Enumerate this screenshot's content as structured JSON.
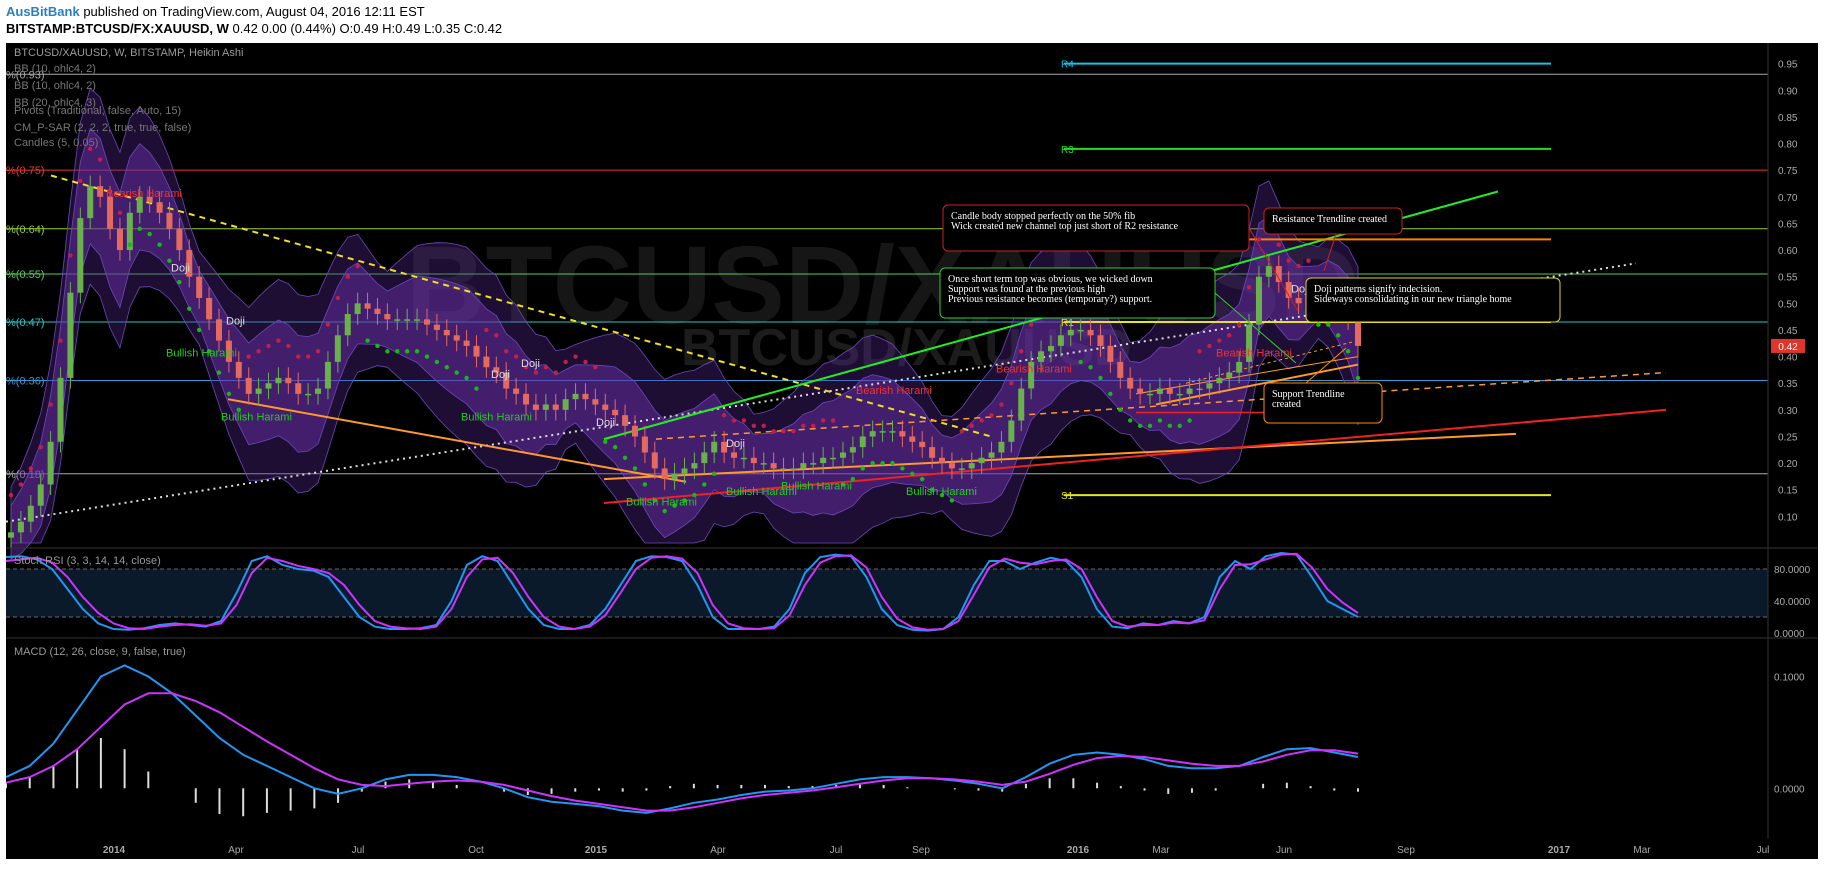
{
  "header": {
    "author": "AusBitBank",
    "published_text": "published on TradingView.com, August 04, 2016 12:11 EST",
    "symbol": "BITSTAMP:BTCUSD/FX:XAUUSD, W",
    "quote": "0.42 0.00 (0.44%)",
    "ohlc": "O:0.49 H:0.49 L:0.35 C:0.42"
  },
  "chart_data": [
    {
      "type": "candlestick",
      "title": "BTCUSD/XAUUSD, W, BITSTAMP, Heikin Ashi",
      "watermark": "BTCUSD/XAUUSD",
      "indicators": [
        "BB (10, ohlc4, 2)",
        "BB (10, ohlc4, 2)",
        "BB (20, ohlc4, 3)",
        "Pivots (Traditional, false, Auto, 15)",
        "CM_P-SAR (2, 2, 2, true, true, false)",
        "Candles (5, 0.05)"
      ],
      "x_ticks": [
        "2014",
        "Apr",
        "Jul",
        "Oct",
        "2015",
        "Apr",
        "Jul",
        "Sep",
        "2016",
        "Mar",
        "Jun",
        "Sep",
        "2017",
        "Mar",
        "Jul"
      ],
      "y_ticks": [
        "0.95",
        "0.90",
        "0.85",
        "0.80",
        "0.75",
        "0.70",
        "0.65",
        "0.60",
        "0.55",
        "0.50",
        "0.45",
        "0.40",
        "0.35",
        "0.30",
        "0.25",
        "0.20",
        "0.15",
        "0.10"
      ],
      "ylim": [
        0.05,
        0.97
      ],
      "last_price": "0.42",
      "candles": [
        0.07,
        0.09,
        0.12,
        0.16,
        0.24,
        0.36,
        0.52,
        0.66,
        0.72,
        0.7,
        0.64,
        0.6,
        0.67,
        0.7,
        0.69,
        0.67,
        0.64,
        0.6,
        0.55,
        0.51,
        0.47,
        0.43,
        0.39,
        0.36,
        0.33,
        0.34,
        0.35,
        0.36,
        0.35,
        0.33,
        0.33,
        0.34,
        0.39,
        0.44,
        0.48,
        0.5,
        0.49,
        0.48,
        0.47,
        0.47,
        0.47,
        0.47,
        0.46,
        0.45,
        0.44,
        0.43,
        0.42,
        0.4,
        0.38,
        0.37,
        0.34,
        0.33,
        0.31,
        0.3,
        0.31,
        0.3,
        0.32,
        0.33,
        0.32,
        0.31,
        0.3,
        0.29,
        0.27,
        0.25,
        0.22,
        0.19,
        0.17,
        0.18,
        0.19,
        0.2,
        0.22,
        0.24,
        0.22,
        0.21,
        0.21,
        0.2,
        0.2,
        0.19,
        0.19,
        0.19,
        0.2,
        0.2,
        0.21,
        0.21,
        0.22,
        0.23,
        0.25,
        0.26,
        0.26,
        0.26,
        0.25,
        0.24,
        0.23,
        0.21,
        0.2,
        0.19,
        0.19,
        0.2,
        0.21,
        0.22,
        0.24,
        0.28,
        0.34,
        0.39,
        0.41,
        0.42,
        0.44,
        0.45,
        0.45,
        0.44,
        0.42,
        0.39,
        0.36,
        0.34,
        0.33,
        0.33,
        0.34,
        0.33,
        0.33,
        0.34,
        0.34,
        0.35,
        0.36,
        0.37,
        0.39,
        0.46,
        0.55,
        0.57,
        0.54,
        0.51,
        0.5,
        0.51,
        0.52,
        0.52,
        0.5,
        0.47,
        0.42
      ],
      "pivot_levels": [
        {
          "label": "R4",
          "value": 0.95,
          "color": "#19c3e6"
        },
        {
          "label": "R3",
          "value": 0.79,
          "color": "#22dd22"
        },
        {
          "label": "R2",
          "value": 0.62,
          "color": "#ff7f00"
        },
        {
          "label": "R1",
          "value": 0.465,
          "color": "#e5e51a"
        },
        {
          "label": "S1",
          "value": 0.14,
          "color": "#e5e51a"
        }
      ],
      "fib_levels": [
        {
          "label": "%(0.93)",
          "value": 0.93,
          "color": "#aaaaaa"
        },
        {
          "label": "%(0.75)",
          "value": 0.75,
          "color": "#e33"
        },
        {
          "label": "%(0.64)",
          "value": 0.64,
          "color": "#9acd32"
        },
        {
          "label": "%(0.55)",
          "value": 0.555,
          "color": "#5c5"
        },
        {
          "label": "%(0.47)",
          "value": 0.465,
          "color": "#26c6c6"
        },
        {
          "label": "%(0.36)",
          "value": 0.355,
          "color": "#3a9ad9"
        },
        {
          "label": "%(0.18)",
          "value": 0.18,
          "color": "#aaaaaa"
        }
      ],
      "pattern_labels": [
        {
          "text": "Bearish Harami",
          "color": "#e33"
        },
        {
          "text": "Doji",
          "color": "#ddd"
        },
        {
          "text": "Bullish Harami",
          "color": "#2c2"
        }
      ],
      "annotations": [
        {
          "id": "note1",
          "lines": [
            "Candle body stopped perfectly on the 50% fib",
            "Wick created new channel top just short of R2 resistance"
          ],
          "border": "#cc2222"
        },
        {
          "id": "note2",
          "lines": [
            "Resistance Trendline created"
          ],
          "border": "#cc2222"
        },
        {
          "id": "note3",
          "lines": [
            "Once short term top was obvious, we wicked down",
            "Support was found at the previous high",
            "Previous resistance becomes (temporary?) support."
          ],
          "border": "#33cc33"
        },
        {
          "id": "note4",
          "lines": [
            "Doji patterns signify indecision.",
            "Sideways consolidating in our new triangle home"
          ],
          "border": "#e5d21a"
        },
        {
          "id": "note5",
          "lines": [
            "Support Trendline",
            "created"
          ],
          "border": "#ff8c00"
        }
      ]
    },
    {
      "type": "line",
      "title": "Stoch RSI (3, 3, 14, 14, close)",
      "y_ticks": [
        "80.0000",
        "40.0000",
        "0.0000"
      ],
      "ylim": [
        0,
        100
      ],
      "series": [
        {
          "color": "#2196f3",
          "values": [
            95,
            96,
            92,
            80,
            55,
            30,
            12,
            5,
            4,
            6,
            10,
            12,
            10,
            8,
            15,
            50,
            90,
            96,
            85,
            80,
            78,
            70,
            45,
            20,
            8,
            5,
            5,
            6,
            10,
            40,
            85,
            96,
            90,
            60,
            30,
            10,
            5,
            5,
            10,
            30,
            60,
            90,
            96,
            95,
            90,
            60,
            20,
            5,
            5,
            5,
            8,
            30,
            75,
            95,
            98,
            96,
            70,
            30,
            10,
            4,
            3,
            5,
            20,
            60,
            90,
            90,
            80,
            88,
            94,
            90,
            70,
            30,
            8,
            6,
            12,
            10,
            15,
            12,
            20,
            70,
            90,
            80,
            96,
            100,
            98,
            70,
            40,
            30,
            20
          ]
        },
        {
          "color": "#cc33ff",
          "values": [
            90,
            92,
            94,
            88,
            70,
            45,
            25,
            12,
            6,
            5,
            8,
            10,
            11,
            9,
            12,
            35,
            75,
            94,
            90,
            84,
            80,
            75,
            60,
            35,
            15,
            8,
            6,
            5,
            8,
            30,
            70,
            92,
            94,
            75,
            45,
            20,
            8,
            5,
            8,
            22,
            50,
            80,
            94,
            96,
            93,
            75,
            35,
            12,
            6,
            5,
            6,
            22,
            60,
            88,
            96,
            97,
            82,
            45,
            18,
            7,
            4,
            5,
            15,
            48,
            82,
            93,
            88,
            86,
            90,
            92,
            80,
            45,
            15,
            8,
            10,
            10,
            13,
            12,
            16,
            55,
            85,
            86,
            92,
            98,
            99,
            82,
            55,
            38,
            25
          ]
        }
      ]
    },
    {
      "type": "bar+line",
      "title": "MACD (12, 26, close, 9, false, true)",
      "y_ticks": [
        "0.1000",
        "0.0000"
      ],
      "ylim": [
        -0.04,
        0.13
      ],
      "macd": [
        0.01,
        0.02,
        0.04,
        0.07,
        0.1,
        0.11,
        0.1,
        0.085,
        0.065,
        0.045,
        0.03,
        0.02,
        0.01,
        0.0,
        -0.005,
        0.0,
        0.008,
        0.012,
        0.012,
        0.01,
        0.006,
        0.0,
        -0.008,
        -0.012,
        -0.014,
        -0.016,
        -0.02,
        -0.022,
        -0.018,
        -0.013,
        -0.01,
        -0.006,
        -0.003,
        -0.002,
        0.0,
        0.004,
        0.008,
        0.01,
        0.01,
        0.009,
        0.007,
        0.004,
        0.0,
        0.01,
        0.022,
        0.03,
        0.032,
        0.03,
        0.026,
        0.02,
        0.018,
        0.018,
        0.02,
        0.028,
        0.035,
        0.036,
        0.032,
        0.028
      ],
      "signal": [
        0.005,
        0.01,
        0.02,
        0.035,
        0.055,
        0.075,
        0.085,
        0.085,
        0.078,
        0.068,
        0.055,
        0.042,
        0.03,
        0.018,
        0.008,
        0.003,
        0.002,
        0.004,
        0.006,
        0.007,
        0.006,
        0.003,
        -0.002,
        -0.007,
        -0.011,
        -0.014,
        -0.017,
        -0.02,
        -0.02,
        -0.017,
        -0.013,
        -0.009,
        -0.006,
        -0.004,
        -0.002,
        0.001,
        0.004,
        0.007,
        0.009,
        0.009,
        0.008,
        0.006,
        0.003,
        0.006,
        0.013,
        0.021,
        0.027,
        0.029,
        0.028,
        0.025,
        0.022,
        0.02,
        0.02,
        0.024,
        0.03,
        0.034,
        0.034,
        0.031
      ],
      "histogram": [
        0.005,
        0.01,
        0.02,
        0.035,
        0.045,
        0.035,
        0.015,
        0.0,
        -0.013,
        -0.023,
        -0.025,
        -0.022,
        -0.02,
        -0.018,
        -0.013,
        -0.003,
        0.006,
        0.008,
        0.006,
        0.003,
        0.0,
        -0.003,
        -0.006,
        -0.005,
        -0.003,
        -0.002,
        -0.003,
        -0.002,
        0.002,
        0.004,
        0.003,
        0.003,
        0.003,
        0.002,
        0.002,
        0.003,
        0.004,
        0.003,
        0.001,
        0.0,
        -0.001,
        -0.002,
        -0.003,
        0.004,
        0.009,
        0.009,
        0.005,
        0.002,
        -0.002,
        -0.005,
        -0.004,
        -0.002,
        0.0,
        0.004,
        0.005,
        0.002,
        -0.002,
        -0.003
      ]
    }
  ]
}
